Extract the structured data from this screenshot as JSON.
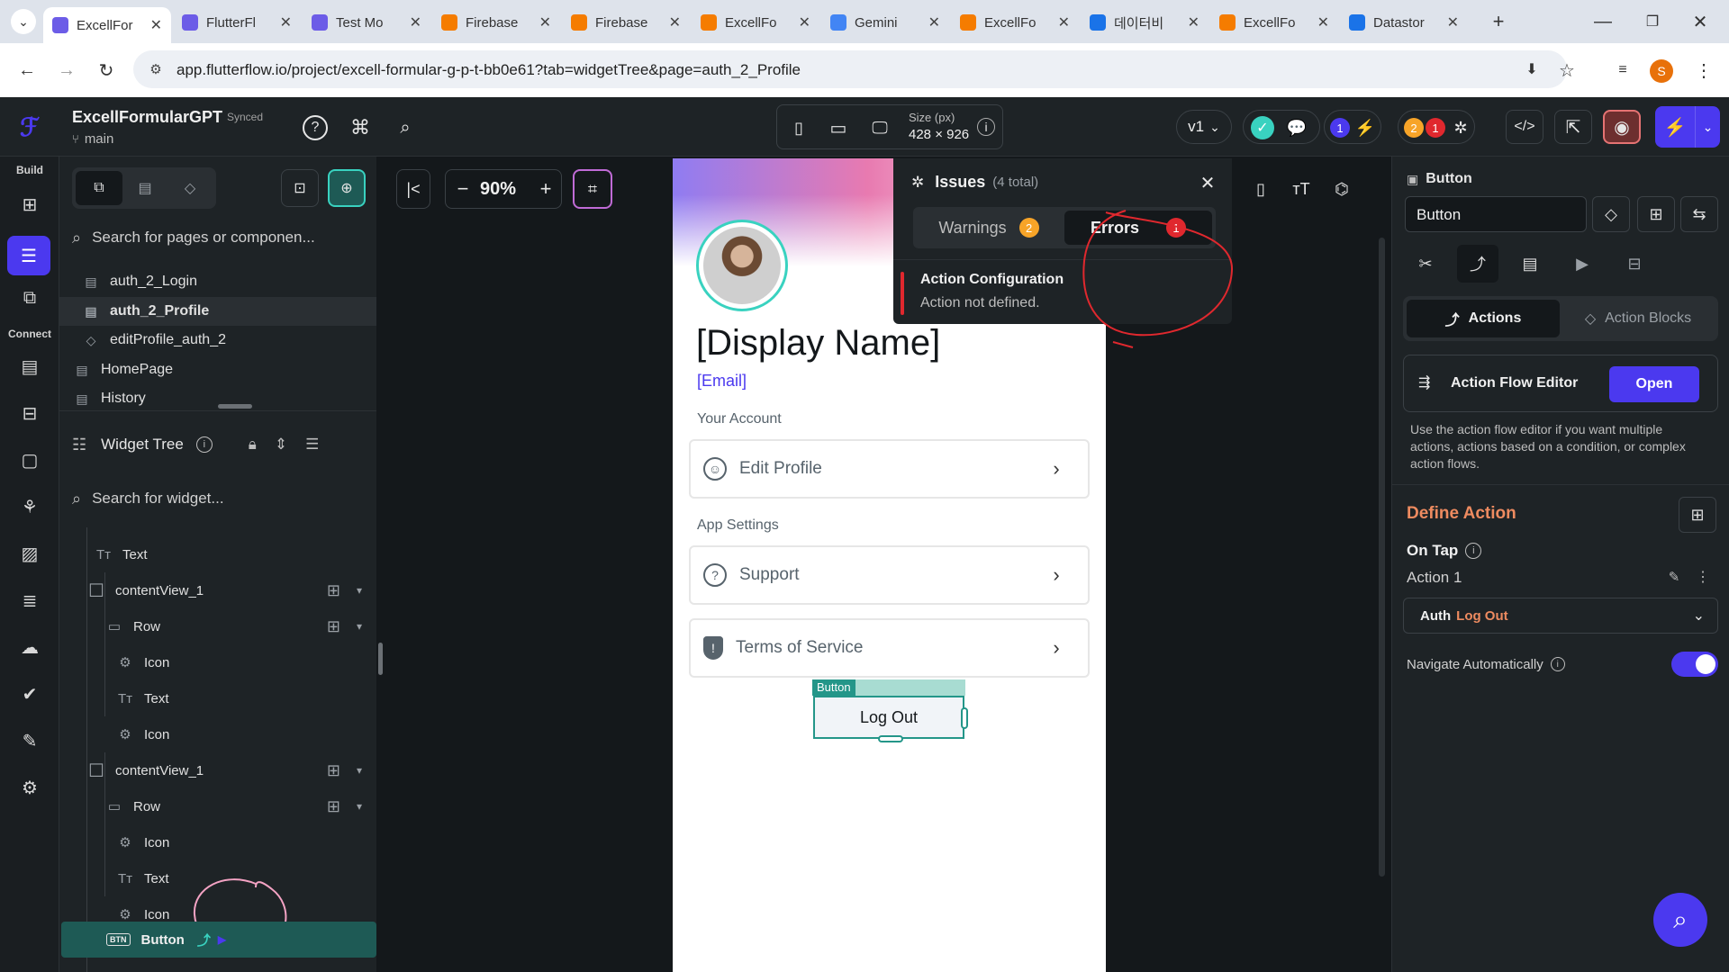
{
  "browser": {
    "tabs": [
      {
        "title": "ExcellFor",
        "active": true,
        "icon_color": "#6c5ce7"
      },
      {
        "title": "FlutterFl",
        "active": false,
        "icon_color": "#6c5ce7"
      },
      {
        "title": "Test Mo",
        "active": false,
        "icon_color": "#6c5ce7"
      },
      {
        "title": "Firebase",
        "active": false,
        "icon_color": "#f57c00"
      },
      {
        "title": "Firebase",
        "active": false,
        "icon_color": "#f57c00"
      },
      {
        "title": "ExcellFo",
        "active": false,
        "icon_color": "#f57c00"
      },
      {
        "title": "Gemini",
        "active": false,
        "icon_color": "#4285f4"
      },
      {
        "title": "ExcellFo",
        "active": false,
        "icon_color": "#f57c00"
      },
      {
        "title": "데이터비",
        "active": false,
        "icon_color": "#1a73e8"
      },
      {
        "title": "ExcellFo",
        "active": false,
        "icon_color": "#f57c00"
      },
      {
        "title": "Datastor",
        "active": false,
        "icon_color": "#1a73e8"
      }
    ],
    "url": "app.flutterflow.io/project/excell-formular-g-p-t-bb0e61?tab=widgetTree&page=auth_2_Profile",
    "profile_initial": "S"
  },
  "topbar": {
    "project_name": "ExcellFormularGPT",
    "sync_status": "Synced",
    "branch": "main",
    "size_label": "Size (px)",
    "size_value": "428 × 926",
    "version": "v1",
    "badge_blue": "1",
    "badge_orange": "2",
    "badge_red": "1"
  },
  "leftrail": {
    "build_label": "Build",
    "connect_label": "Connect"
  },
  "navpanel": {
    "search_placeholder": "Search for pages or componen...",
    "pages": [
      {
        "label": "auth_2_Login",
        "selected": false
      },
      {
        "label": "auth_2_Profile",
        "selected": true
      },
      {
        "label": "editProfile_auth_2",
        "selected": false
      },
      {
        "label": "HomePage",
        "selected": false
      },
      {
        "label": "History",
        "selected": false
      }
    ],
    "widget_tree_title": "Widget Tree",
    "widget_search_placeholder": "Search for widget...",
    "tree": [
      {
        "label": "Text",
        "icon": "Tт"
      },
      {
        "label": "contentView_1",
        "icon": "☐"
      },
      {
        "label": "Row",
        "icon": "▭"
      },
      {
        "label": "Icon",
        "icon": "⚙"
      },
      {
        "label": "Text",
        "icon": "Tт"
      },
      {
        "label": "Icon",
        "icon": "⚙"
      },
      {
        "label": "contentView_1",
        "icon": "☐"
      },
      {
        "label": "Row",
        "icon": "▭"
      },
      {
        "label": "Icon",
        "icon": "⚙"
      },
      {
        "label": "Text",
        "icon": "Tт"
      },
      {
        "label": "Icon",
        "icon": "⚙"
      },
      {
        "label": "Button",
        "icon": "▣"
      }
    ]
  },
  "canvas": {
    "zoom": "90%",
    "display_name": "[Display Name]",
    "email": "[Email]",
    "section_account": "Your Account",
    "edit_profile": "Edit Profile",
    "section_settings": "App Settings",
    "support": "Support",
    "terms": "Terms of Service",
    "button_tag": "Button",
    "logout": "Log Out"
  },
  "issues": {
    "title": "Issues",
    "count": "(4 total)",
    "warnings_tab": "Warnings",
    "warnings_count": "2",
    "errors_tab": "Errors",
    "errors_count": "1",
    "error_title": "Action Configuration",
    "error_desc": "Action not defined."
  },
  "rightpanel": {
    "widget_type": "Button",
    "widget_name": "Button",
    "tab_actions": "Actions",
    "tab_action_blocks": "Action Blocks",
    "flow_editor_label": "Action Flow Editor",
    "open_button": "Open",
    "flow_editor_desc": "Use the action flow editor if you want multiple actions, actions based on a condition, or complex action flows.",
    "define_action": "Define Action",
    "on_tap": "On Tap",
    "action_1": "Action 1",
    "action_prefix": "Auth",
    "action_value": "Log Out",
    "navigate_auto": "Navigate Automatically",
    "navigate_auto_on": true
  },
  "colors": {
    "accent": "#4b39ef",
    "error_red": "#e0282e",
    "warning_orange": "#f7a428",
    "teal": "#249689"
  }
}
